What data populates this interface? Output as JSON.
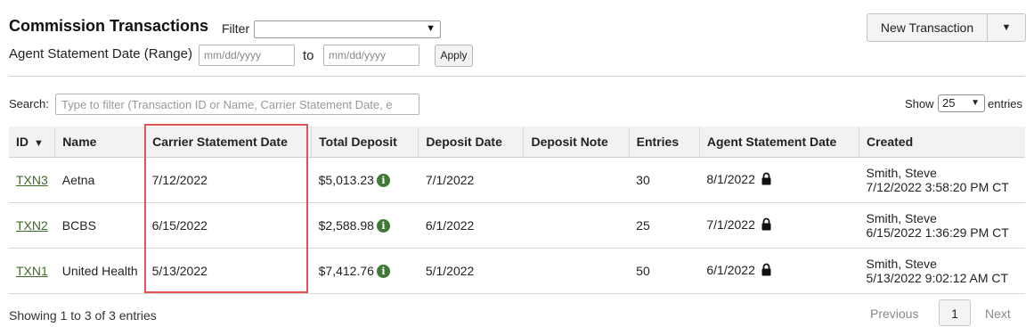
{
  "header": {
    "title": "Commission Transactions",
    "filter_label": "Filter",
    "filter_value": "",
    "date_range_label": "Agent Statement Date (Range)",
    "date_from_placeholder": "mm/dd/yyyy",
    "to_label": "to",
    "date_to_placeholder": "mm/dd/yyyy",
    "apply_label": "Apply",
    "new_transaction_label": "New Transaction"
  },
  "search": {
    "label": "Search:",
    "placeholder": "Type to filter (Transaction ID or Name, Carrier Statement Date, e"
  },
  "page_size": {
    "show_label": "Show",
    "value": "25",
    "entries_label": "entries"
  },
  "table": {
    "columns": [
      "ID",
      "Name",
      "Carrier Statement Date",
      "Total Deposit",
      "Deposit Date",
      "Deposit Note",
      "Entries",
      "Agent Statement Date",
      "Created"
    ],
    "rows": [
      {
        "id": "TXN3",
        "name": "Aetna",
        "carrier_date": "7/12/2022",
        "total_deposit": "$5,013.23",
        "deposit_date": "7/1/2022",
        "deposit_note": "",
        "entries": "30",
        "agent_date": "8/1/2022",
        "created_by": "Smith, Steve",
        "created_at": "7/12/2022 3:58:20 PM CT"
      },
      {
        "id": "TXN2",
        "name": "BCBS",
        "carrier_date": "6/15/2022",
        "total_deposit": "$2,588.98",
        "deposit_date": "6/1/2022",
        "deposit_note": "",
        "entries": "25",
        "agent_date": "7/1/2022",
        "created_by": "Smith, Steve",
        "created_at": "6/15/2022 1:36:29 PM CT"
      },
      {
        "id": "TXN1",
        "name": "United Health",
        "carrier_date": "5/13/2022",
        "total_deposit": "$7,412.76",
        "deposit_date": "5/1/2022",
        "deposit_note": "",
        "entries": "50",
        "agent_date": "6/1/2022",
        "created_by": "Smith, Steve",
        "created_at": "5/13/2022 9:02:12 AM CT"
      }
    ]
  },
  "footer": {
    "info": "Showing 1 to 3 of 3 entries",
    "previous_label": "Previous",
    "current_page": "1",
    "next_label": "Next"
  },
  "colors": {
    "link": "#3d6b2c",
    "info_icon": "#3f7a34",
    "highlight": "#e25353"
  },
  "icons": {
    "sort": "sort-desc-icon",
    "info": "info-icon",
    "lock": "lock-icon",
    "dropdown": "chevron-down-icon"
  }
}
